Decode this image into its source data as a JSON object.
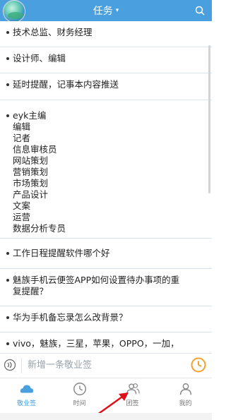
{
  "header": {
    "title": "任务",
    "chevron": "▾"
  },
  "list": [
    {
      "lines": [
        "技术总监、财务经理"
      ]
    },
    {
      "lines": [
        "设计师、编辑"
      ]
    },
    {
      "lines": [
        "延时提醒，记事本内容推送"
      ]
    },
    {
      "lines": [
        "eyk主编",
        "编辑",
        "记者",
        "信息审核员",
        "网站策划",
        "营销策划",
        "市场策划",
        "产品设计",
        "文案",
        "运营",
        "数据分析专员"
      ]
    },
    {
      "lines": [
        "工作日程提醒软件哪个好"
      ]
    },
    {
      "lines": [
        "魅族手机云便签APP如何设置待办事项的重",
        "复提醒？"
      ]
    },
    {
      "lines": [
        "华为手机备忘录怎么改背景？"
      ]
    },
    {
      "lines": [
        "vivo，魅族，三星，苹果，OPPO，一加，"
      ]
    }
  ],
  "input": {
    "placeholder": "新增一条敬业签"
  },
  "tabs": [
    {
      "label": "敬业签",
      "icon": "cloud-icon",
      "active": true
    },
    {
      "label": "时间",
      "icon": "clock-icon",
      "active": false
    },
    {
      "label": "团签",
      "icon": "team-icon",
      "active": false
    },
    {
      "label": "我的",
      "icon": "person-icon",
      "active": false
    }
  ],
  "colors": {
    "accent": "#4a9fde",
    "clock": "#f0a22e",
    "arrow": "#e0101a"
  }
}
